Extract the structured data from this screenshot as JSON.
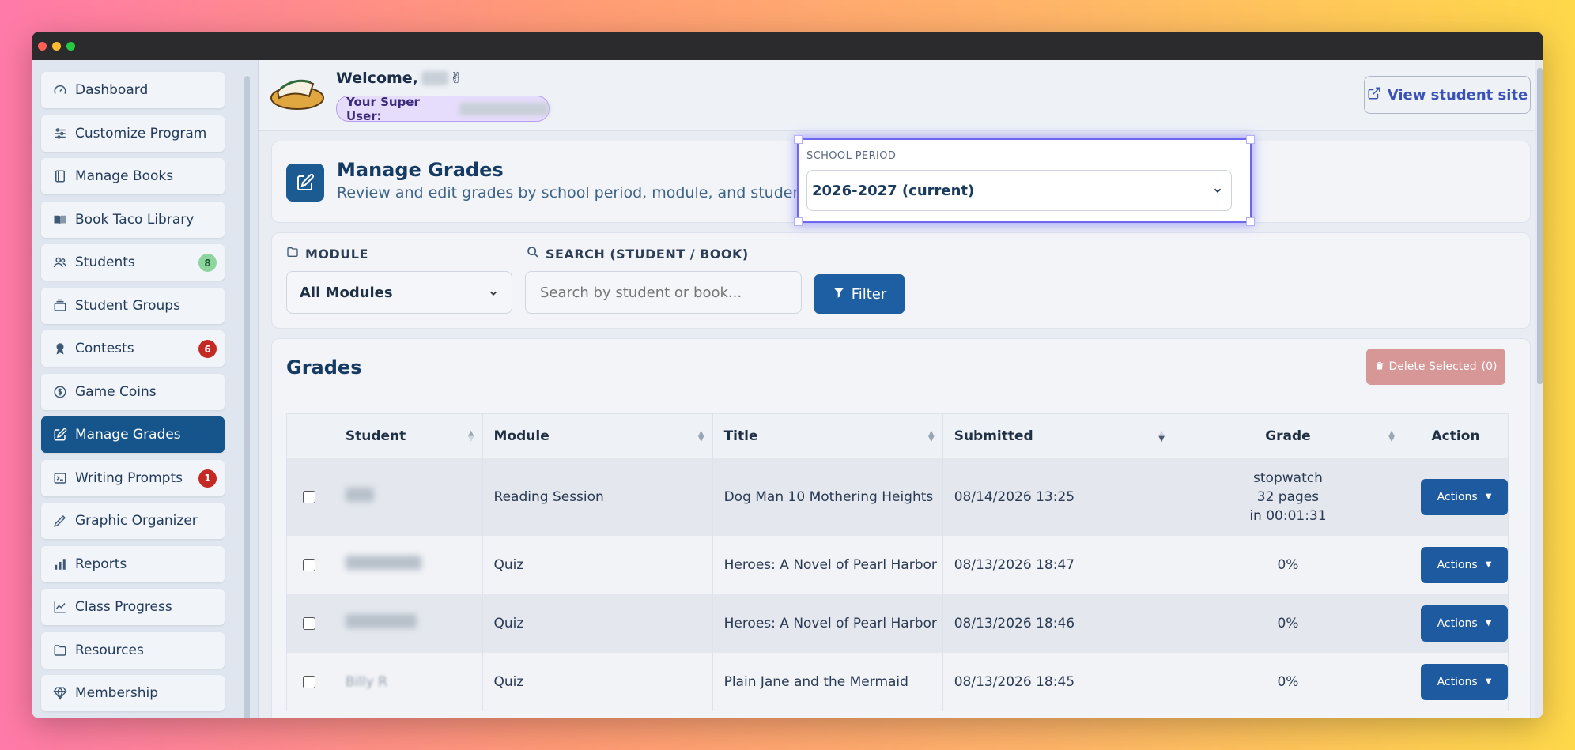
{
  "sidebar": {
    "items": [
      {
        "label": "Dashboard",
        "icon": "gauge-icon"
      },
      {
        "label": "Customize Program",
        "icon": "sliders-icon"
      },
      {
        "label": "Manage Books",
        "icon": "notebook-icon"
      },
      {
        "label": "Book Taco Library",
        "icon": "book-open-icon"
      },
      {
        "label": "Students",
        "icon": "users-icon",
        "badge": "8"
      },
      {
        "label": "Student Groups",
        "icon": "layers-icon"
      },
      {
        "label": "Contests",
        "icon": "award-icon",
        "badge": "6"
      },
      {
        "label": "Game Coins",
        "icon": "coin-icon"
      },
      {
        "label": "Manage Grades",
        "icon": "edit-icon"
      },
      {
        "label": "Writing Prompts",
        "icon": "terminal-icon",
        "badge": "1"
      },
      {
        "label": "Graphic Organizer",
        "icon": "pen-icon"
      },
      {
        "label": "Reports",
        "icon": "bar-chart-icon"
      },
      {
        "label": "Class Progress",
        "icon": "line-chart-icon"
      },
      {
        "label": "Resources",
        "icon": "folder-icon"
      },
      {
        "label": "Membership",
        "icon": "diamond-icon"
      }
    ]
  },
  "topbar": {
    "welcome": "Welcome,",
    "wave_emoji": "✌",
    "super_user_label": "Your Super User:",
    "view_site": "View student site"
  },
  "header": {
    "title": "Manage Grades",
    "subtitle": "Review and edit grades by school period, module, and student"
  },
  "period": {
    "label": "SCHOOL PERIOD",
    "value": "2026-2027 (current)"
  },
  "filters": {
    "module_label": "MODULE",
    "module_value": "All Modules",
    "search_label": "SEARCH (STUDENT / BOOK)",
    "search_placeholder": "Search by student or book...",
    "filter_button": "Filter"
  },
  "grades": {
    "title": "Grades",
    "delete_button": "Delete Selected",
    "delete_count": "(0)",
    "columns": [
      "Student",
      "Module",
      "Title",
      "Submitted",
      "Grade",
      "Action"
    ],
    "rows": [
      {
        "student": "",
        "module": "Reading Session",
        "title": "Dog Man 10 Mothering Heights",
        "submitted": "08/14/2026 13:25",
        "grade_line1": "stopwatch",
        "grade_line2": "32 pages",
        "grade_line3": "in 00:01:31",
        "action": "Actions"
      },
      {
        "student": "",
        "module": "Quiz",
        "title": "Heroes: A Novel of Pearl Harbor",
        "submitted": "08/13/2026 18:47",
        "grade": "0%",
        "action": "Actions"
      },
      {
        "student": "",
        "module": "Quiz",
        "title": "Heroes: A Novel of Pearl Harbor",
        "submitted": "08/13/2026 18:46",
        "grade": "0%",
        "action": "Actions"
      },
      {
        "student": "Billy R",
        "module": "Quiz",
        "title": "Plain Jane and the Mermaid",
        "submitted": "08/13/2026 18:45",
        "grade": "0%",
        "action": "Actions"
      }
    ]
  }
}
